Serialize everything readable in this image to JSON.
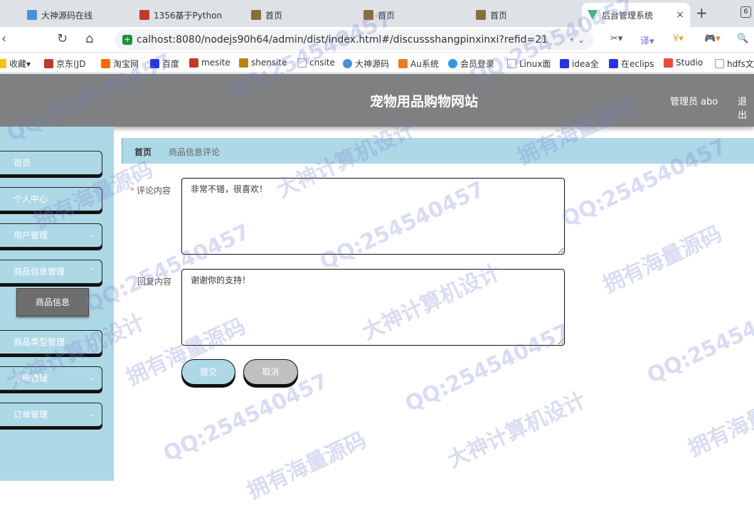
{
  "browser": {
    "tabs": [
      {
        "label": "大神源码在线",
        "color": "#4a8fd8"
      },
      {
        "label": "1356基于Python",
        "color": "#c0392b"
      },
      {
        "label": "首页",
        "color": "#8a6d3b"
      },
      {
        "label": "首页",
        "color": "#8a6d3b"
      },
      {
        "label": "首页",
        "color": "#8a6d3b"
      },
      {
        "label": "后台管理系统",
        "color": "#41b883",
        "close": "×"
      }
    ],
    "new_tab": "+",
    "tab_count": "6",
    "url": "calhost:8080/nodejs90h64/admin/dist/index.html#/discussshangpinxinxi?refid=21",
    "bookmarks": [
      {
        "label": "收藏",
        "color": "#f1c40f"
      },
      {
        "label": "京东(JD",
        "color": "#c0392b"
      },
      {
        "label": "淘宝网",
        "color": "#ff6a00"
      },
      {
        "label": "百度",
        "color": "#2932e1"
      },
      {
        "label": "mesite",
        "color": "#c0392b"
      },
      {
        "label": "shensite",
        "color": "#b8860b"
      },
      {
        "label": "cnsite",
        "color": "#999999"
      },
      {
        "label": "大神源码",
        "color": "#4a8fd8"
      },
      {
        "label": "Au系统",
        "color": "#e67e22"
      },
      {
        "label": "会员登录",
        "color": "#3498db"
      },
      {
        "label": "Linux面",
        "color": "#999999"
      },
      {
        "label": "idea全",
        "color": "#2932e1"
      },
      {
        "label": "在eclips",
        "color": "#2932e1"
      },
      {
        "label": "Studio",
        "color": "#e74c3c"
      },
      {
        "label": "hdfs文",
        "color": "#999999"
      }
    ]
  },
  "header": {
    "title": "宠物用品购物网站",
    "user": "管理员 abo",
    "logout": "退出"
  },
  "sidebar": {
    "items": [
      {
        "label": "首页",
        "has_children": false
      },
      {
        "label": "个人中心",
        "has_children": true
      },
      {
        "label": "用户管理",
        "has_children": true
      },
      {
        "label": "商品信息管理",
        "has_children": true
      },
      {
        "label": "商品类型管理",
        "has_children": true
      },
      {
        "label": "系统管理",
        "has_children": true
      },
      {
        "label": "订单管理",
        "has_children": true
      }
    ],
    "submenu_label": "商品信息"
  },
  "breadcrumb": {
    "home": "首页",
    "current": "商品信息评论"
  },
  "form": {
    "comment_label": "评论内容",
    "comment_value": "非常不错，很喜欢！",
    "reply_label": "回复内容",
    "reply_value": "谢谢你的支持！",
    "submit_label": "提交",
    "cancel_label": "取消"
  },
  "watermarks": [
    {
      "text": "QQ:254540457"
    },
    {
      "text": "拥有海量源码"
    },
    {
      "text": "大神计算机设计"
    }
  ]
}
